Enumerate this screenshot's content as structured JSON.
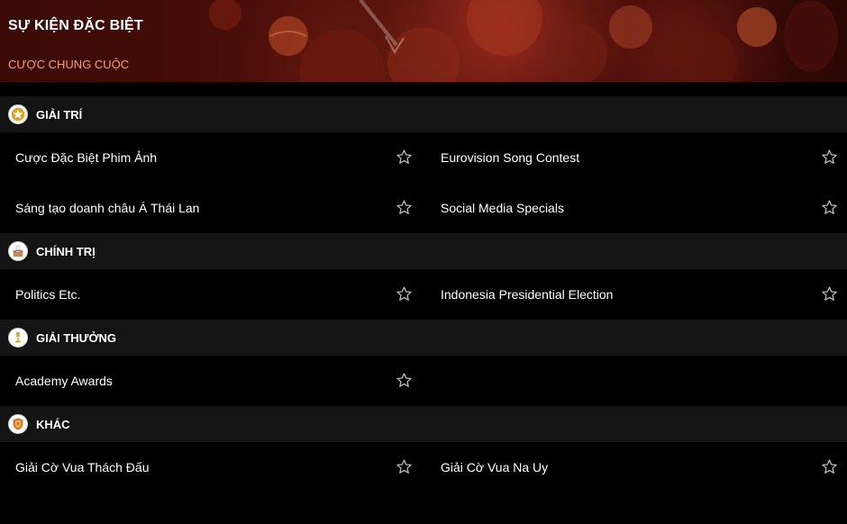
{
  "banner": {
    "title": "SỰ KIỆN ĐẶC BIỆT",
    "subtitle": "CƯỢC CHUNG CUỘC"
  },
  "colors": {
    "accent": "#f3a26a",
    "section_bg": "#141414",
    "background": "#000000",
    "icon_gold": "#e2a21c"
  },
  "sections": [
    {
      "label": "GIẢI TRÍ",
      "icon": "star-icon",
      "items": [
        [
          "Cược Đặc Biệt Phim Ảnh",
          "Eurovision Song Contest"
        ],
        [
          "Sáng tạo doanh châu Á Thái Lan",
          "Social Media Specials"
        ]
      ]
    },
    {
      "label": "CHÍNH TRỊ",
      "icon": "ballot-box-icon",
      "items": [
        [
          "Politics Etc.",
          "Indonesia Presidential Election"
        ]
      ]
    },
    {
      "label": "GIẢI THƯỞNG",
      "icon": "trophy-icon",
      "items": [
        [
          "Academy Awards",
          null
        ]
      ]
    },
    {
      "label": "KHÁC",
      "icon": "shield-icon",
      "items": [
        [
          "Giải Cờ Vua Thách Đấu",
          "Giải Cờ Vua Na Uy"
        ]
      ]
    }
  ]
}
